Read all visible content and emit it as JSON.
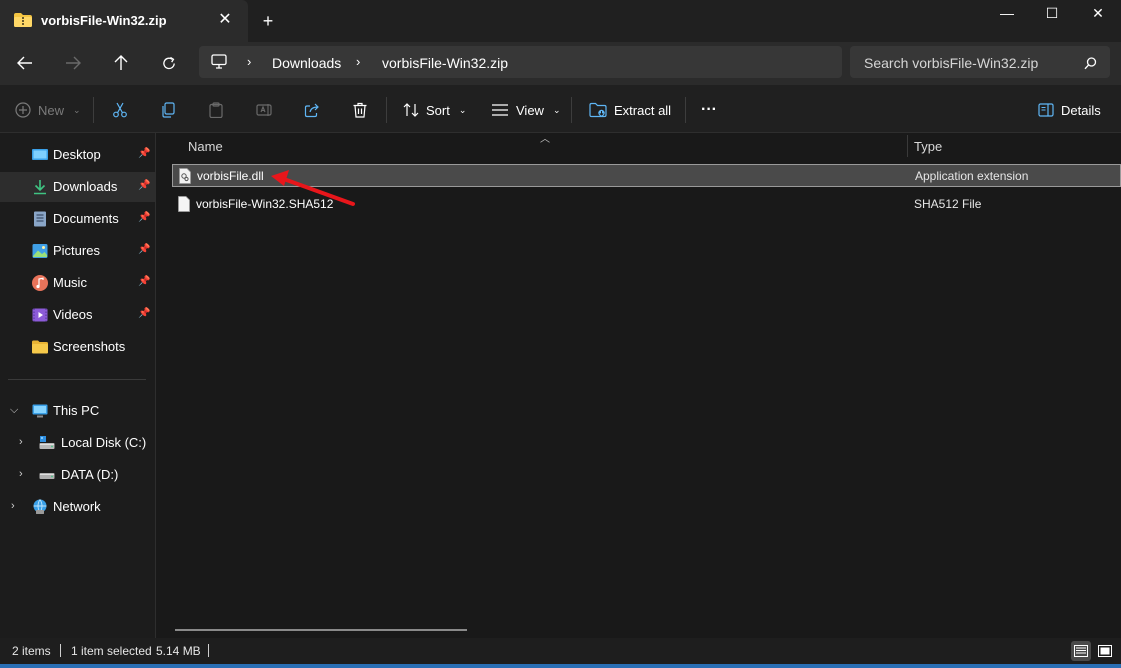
{
  "window": {
    "tab_title": "vorbisFile-Win32.zip",
    "tab_close": "✕",
    "new_tab": "+",
    "minimize": "—",
    "maximize": "☐",
    "close": "✕"
  },
  "address": {
    "crumbs": [
      "Downloads",
      "vorbisFile-Win32.zip"
    ],
    "search_placeholder": "Search vorbisFile-Win32.zip"
  },
  "commands": {
    "new_label": "New",
    "sort_label": "Sort",
    "view_label": "View",
    "extract_label": "Extract all",
    "more_label": "···",
    "details_label": "Details"
  },
  "sidebar": {
    "quick_access": [
      {
        "label": "Desktop",
        "icon": "desktop-icon",
        "pinned": true
      },
      {
        "label": "Downloads",
        "icon": "download-icon",
        "pinned": true,
        "selected": true
      },
      {
        "label": "Documents",
        "icon": "documents-icon",
        "pinned": true
      },
      {
        "label": "Pictures",
        "icon": "pictures-icon",
        "pinned": true
      },
      {
        "label": "Music",
        "icon": "music-icon",
        "pinned": true
      },
      {
        "label": "Videos",
        "icon": "videos-icon",
        "pinned": true
      },
      {
        "label": "Screenshots",
        "icon": "folder-icon",
        "pinned": false
      }
    ],
    "tree": [
      {
        "label": "This PC",
        "icon": "this-pc-icon",
        "expanded": true
      },
      {
        "label": "Local Disk (C:)",
        "icon": "local-disk-icon",
        "expanded": false
      },
      {
        "label": "DATA (D:)",
        "icon": "drive-icon",
        "expanded": false
      },
      {
        "label": "Network",
        "icon": "network-icon",
        "expanded": false
      }
    ]
  },
  "list": {
    "columns": [
      "Name",
      "Type"
    ],
    "rows": [
      {
        "name": "vorbisFile.dll",
        "type": "Application extension",
        "selected": true
      },
      {
        "name": "vorbisFile-Win32.SHA512",
        "type": "SHA512 File",
        "selected": false
      }
    ]
  },
  "status": {
    "items_count": "2 items",
    "selected_info": "1 item selected",
    "size": "5.14 MB"
  },
  "colors": {
    "accent": "#2a6fb5",
    "annotation_arrow": "#e8161b",
    "folder_yellow": "#f4c542"
  }
}
